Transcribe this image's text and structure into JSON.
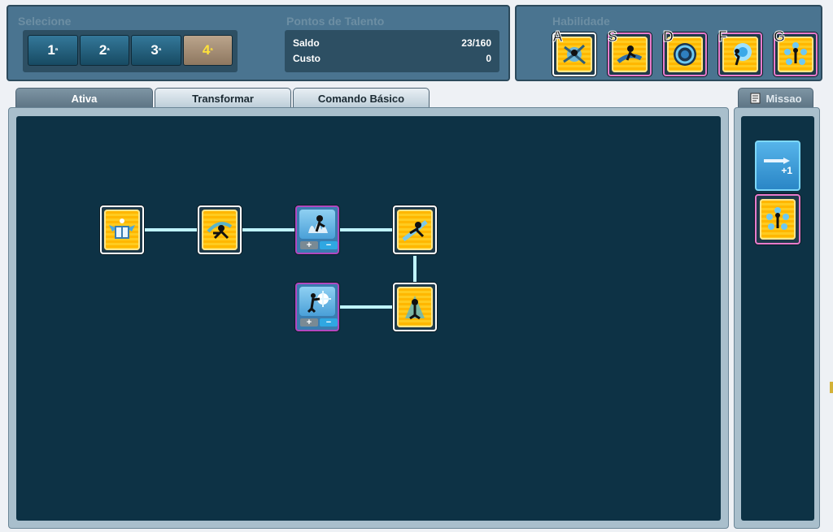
{
  "select_panel": {
    "title": "Selecione",
    "ranks": [
      {
        "num": "1",
        "sup": "ª"
      },
      {
        "num": "2",
        "sup": "ª"
      },
      {
        "num": "3",
        "sup": "ª"
      },
      {
        "num": "4",
        "sup": "ª"
      }
    ],
    "active_rank": 4
  },
  "talent_points": {
    "title": "Pontos de Talento",
    "balance_label": "Saldo",
    "balance_value": "23/160",
    "cost_label": "Custo",
    "cost_value": "0"
  },
  "skills_panel": {
    "title": "Habilidade",
    "keys": [
      "A",
      "S",
      "D",
      "F",
      "G"
    ]
  },
  "tabs": [
    {
      "label": "Ativa",
      "active": true
    },
    {
      "label": "Transformar",
      "active": false
    },
    {
      "label": "Comando Básico",
      "active": false
    }
  ],
  "side": {
    "tab_label": "Missao",
    "boost_label": "+1"
  },
  "node_controls": {
    "plus": "+",
    "minus": "−"
  },
  "colors": {
    "panel_bg": "#4a7490",
    "tree_bg": "#0d3245",
    "link": "#bff3ff",
    "icon_gold": "#ffb700",
    "active_rank_text": "#ffe23a"
  }
}
